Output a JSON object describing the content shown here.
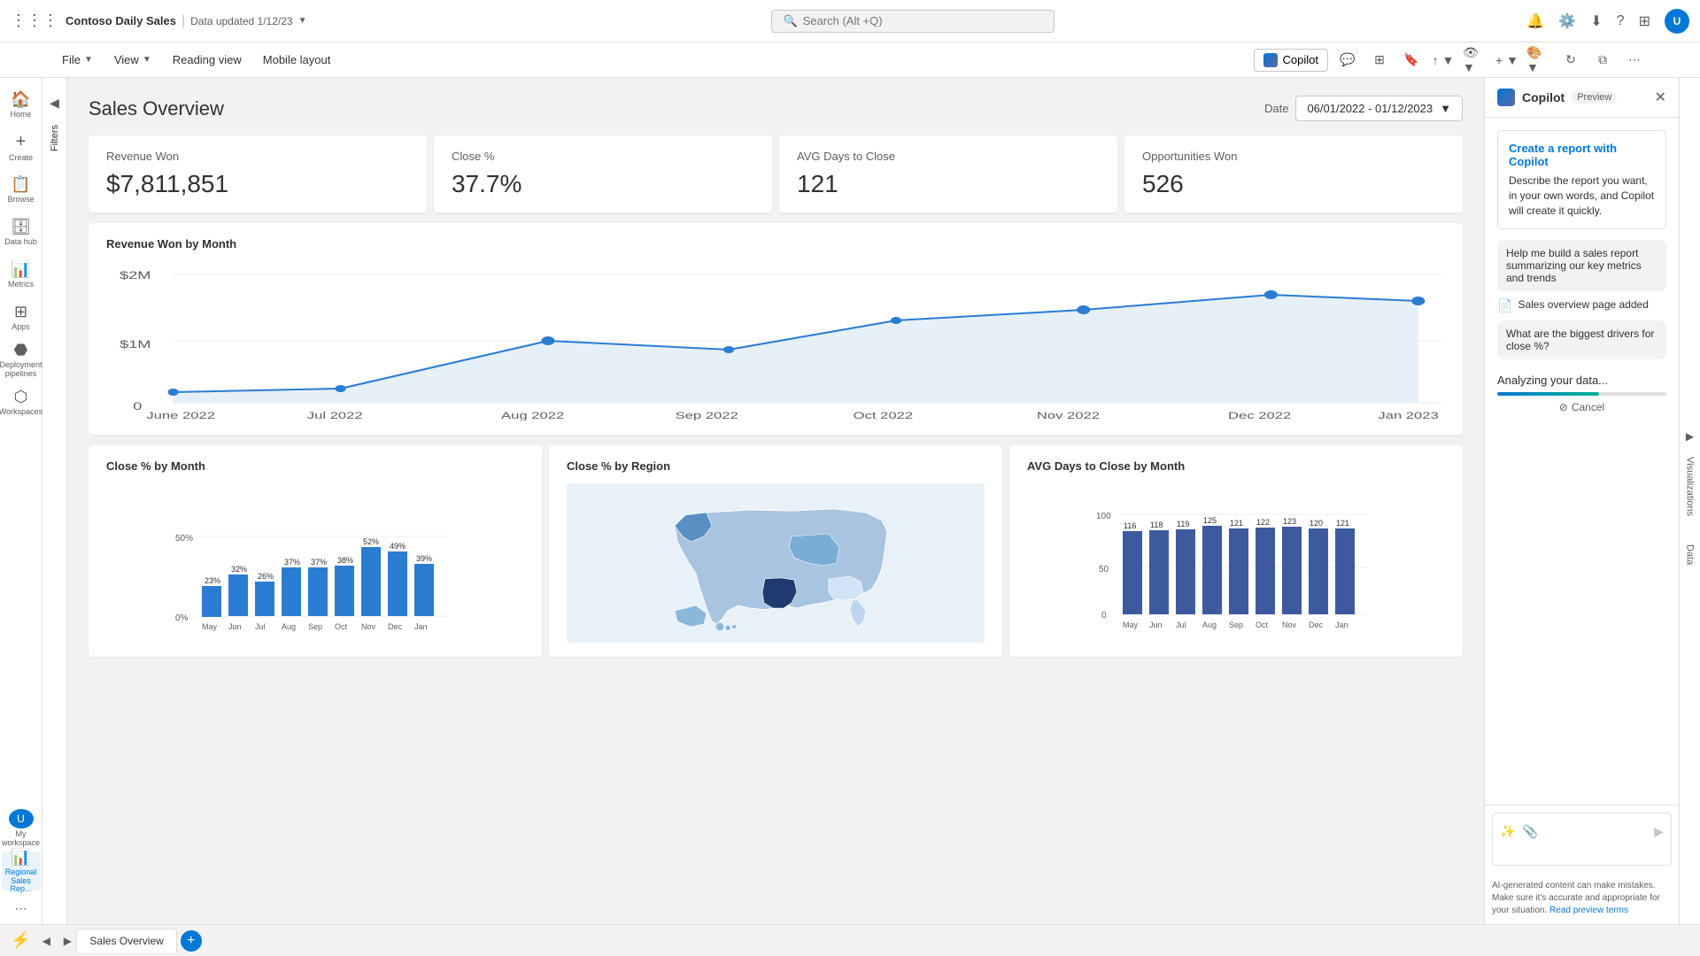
{
  "app": {
    "title": "Contoso Daily Sales",
    "data_updated": "Data updated 1/12/23",
    "search_placeholder": "Search (Alt +Q)"
  },
  "topbar": {
    "icons": [
      "bell",
      "gear",
      "download",
      "help",
      "apps"
    ],
    "avatar_initials": "U"
  },
  "menubar": {
    "items": [
      "File",
      "View",
      "Reading view",
      "Mobile layout"
    ],
    "copilot_label": "Copilot",
    "toolbar_icons": [
      "comment",
      "table-view",
      "bookmark",
      "share",
      "view-toggle",
      "add-visual",
      "format",
      "refresh",
      "copy",
      "more"
    ]
  },
  "sidebar": {
    "items": [
      {
        "label": "Home",
        "icon": "🏠"
      },
      {
        "label": "Create",
        "icon": "+"
      },
      {
        "label": "Browse",
        "icon": "📋"
      },
      {
        "label": "Data hub",
        "icon": "🗄"
      },
      {
        "label": "Metrics",
        "icon": "📊"
      },
      {
        "label": "Apps",
        "icon": "⊞"
      },
      {
        "label": "Deployment pipelines",
        "icon": "⬣"
      },
      {
        "label": "Workspaces",
        "icon": "⬡"
      },
      {
        "label": "My workspace",
        "icon": "👤"
      },
      {
        "label": "Regional Sales Rep...",
        "icon": "📊",
        "active": true
      }
    ]
  },
  "report": {
    "title": "Sales Overview",
    "date_label": "Date",
    "date_range": "06/01/2022 - 01/12/2023",
    "kpis": [
      {
        "label": "Revenue Won",
        "value": "$7,811,851"
      },
      {
        "label": "Close %",
        "value": "37.7%"
      },
      {
        "label": "AVG Days to Close",
        "value": "121"
      },
      {
        "label": "Opportunities Won",
        "value": "526"
      }
    ],
    "line_chart": {
      "title": "Revenue Won by Month",
      "y_labels": [
        "$2M",
        "$1M",
        "0"
      ],
      "x_labels": [
        "June 2022",
        "Jul 2022",
        "Aug 2022",
        "Sep 2022",
        "Oct 2022",
        "Nov 2022",
        "Dec 2022",
        "Jan 2023"
      ],
      "data_points": [
        {
          "x": 0,
          "y": 0.1
        },
        {
          "x": 1,
          "y": 0.12
        },
        {
          "x": 2,
          "y": 0.45
        },
        {
          "x": 3,
          "y": 0.38
        },
        {
          "x": 4,
          "y": 0.62
        },
        {
          "x": 5,
          "y": 0.75
        },
        {
          "x": 6,
          "y": 0.88
        },
        {
          "x": 7,
          "y": 0.82
        }
      ]
    },
    "bar_chart_close": {
      "title": "Close % by Month",
      "x_labels": [
        "May",
        "Jun",
        "Jul",
        "Aug",
        "Sep",
        "Oct",
        "Nov",
        "Dec",
        "Jan"
      ],
      "values": [
        23,
        32,
        26,
        37,
        37,
        38,
        52,
        49,
        39
      ],
      "y_label": "50%",
      "y_label2": "0%"
    },
    "map_chart": {
      "title": "Close % by Region"
    },
    "bar_chart_avg": {
      "title": "AVG Days to Close by Month",
      "x_labels": [
        "May",
        "Jun",
        "Jul",
        "Aug",
        "Sep",
        "Oct",
        "Nov",
        "Dec",
        "Jan"
      ],
      "values": [
        116,
        118,
        119,
        125,
        121,
        122,
        123,
        120,
        121
      ],
      "y_labels": [
        "100",
        "50",
        "0"
      ]
    }
  },
  "copilot": {
    "title": "Copilot",
    "preview_label": "Preview",
    "create_section": {
      "title": "Create a report with Copilot",
      "description": "Describe the report you want, in your own words, and Copilot will create it quickly."
    },
    "messages": [
      {
        "type": "bubble",
        "text": "Help me build a sales report summarizing our key metrics and trends"
      },
      {
        "type": "action",
        "text": "Sales overview page added"
      },
      {
        "type": "bubble",
        "text": "What are the biggest drivers for close %?"
      }
    ],
    "analyzing_text": "Analyzing your data...",
    "cancel_label": "Cancel",
    "disclaimer": "AI-generated content can make mistakes. Make sure it's accurate and appropriate for your situation.",
    "read_preview_label": "Read preview terms"
  },
  "bottom_tab": {
    "label": "Sales Overview",
    "add_tooltip": "New page"
  },
  "filters_label": "Filters",
  "visualizations_label": "Visualizations",
  "data_label": "Data"
}
